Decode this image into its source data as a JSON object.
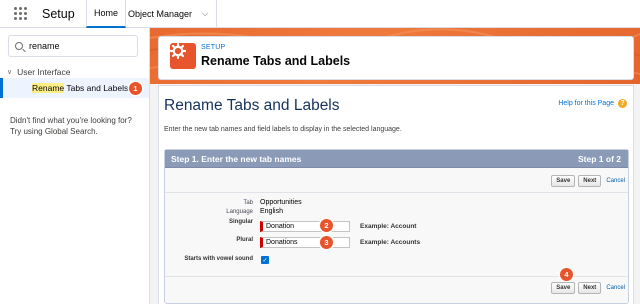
{
  "topbar": {
    "app_name": "Setup",
    "tabs": [
      {
        "label": "Home"
      },
      {
        "label": "Object Manager"
      }
    ]
  },
  "sidebar": {
    "search_value": "rename",
    "tree_parent": "User Interface",
    "tree_child_highlight": "Rename",
    "tree_child_rest": " Tabs and Labels",
    "no_result_text": "Didn't find what you're looking for? Try using Global Search."
  },
  "header": {
    "eyebrow": "SETUP",
    "title": "Rename Tabs and Labels"
  },
  "page": {
    "title": "Rename Tabs and Labels",
    "help_link": "Help for this Page",
    "help_icon": "?",
    "intro": "Enter the new tab names and field labels to display in the selected language."
  },
  "step": {
    "title": "Step 1. Enter the new tab names",
    "progress": "Step 1 of 2",
    "buttons": {
      "save": "Save",
      "next": "Next",
      "cancel": "Cancel"
    },
    "fields": {
      "tab_label": "Tab",
      "tab_value": "Opportunities",
      "language_label": "Language",
      "language_value": "English",
      "singular_label": "Singular",
      "singular_value": "Donation",
      "singular_example": "Example: Account",
      "plural_label": "Plural",
      "plural_value": "Donations",
      "plural_example": "Example: Accounts",
      "vowel_label": "Starts with vowel sound",
      "vowel_checked": "✓"
    }
  },
  "badges": [
    "1",
    "2",
    "3",
    "4"
  ],
  "colors": {
    "accent": "#0070d2",
    "badge": "#e8542c",
    "header_orange": "#e8692f",
    "step_header": "#8a9ab7",
    "required": "#cc0000"
  }
}
